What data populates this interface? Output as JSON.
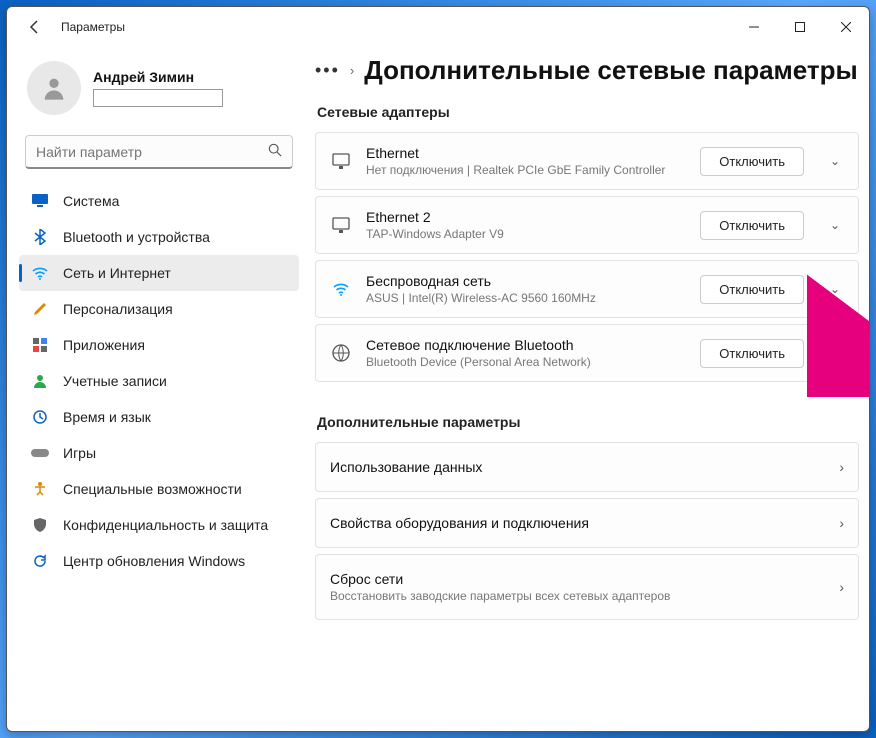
{
  "window": {
    "title": "Параметры"
  },
  "profile": {
    "name": "Андрей Зимин"
  },
  "search": {
    "placeholder": "Найти параметр"
  },
  "nav": [
    {
      "label": "Система",
      "icon": "monitor",
      "cls": "ic-system"
    },
    {
      "label": "Bluetooth и устройства",
      "icon": "bluetooth",
      "cls": "ic-bt"
    },
    {
      "label": "Сеть и Интернет",
      "icon": "wifi",
      "cls": "ic-net",
      "active": true
    },
    {
      "label": "Персонализация",
      "icon": "brush",
      "cls": "ic-pers"
    },
    {
      "label": "Приложения",
      "icon": "apps",
      "cls": "ic-app"
    },
    {
      "label": "Учетные записи",
      "icon": "user",
      "cls": "ic-acc"
    },
    {
      "label": "Время и язык",
      "icon": "clock",
      "cls": "ic-time"
    },
    {
      "label": "Игры",
      "icon": "gamepad",
      "cls": "ic-game"
    },
    {
      "label": "Специальные возможности",
      "icon": "accessibility",
      "cls": "ic-acc2"
    },
    {
      "label": "Конфиденциальность и защита",
      "icon": "shield",
      "cls": "ic-priv"
    },
    {
      "label": "Центр обновления Windows",
      "icon": "update",
      "cls": "ic-upd"
    }
  ],
  "page": {
    "dots": "•••",
    "title": "Дополнительные сетевые параметры"
  },
  "sections": {
    "adapters_label": "Сетевые адаптеры",
    "additional_label": "Дополнительные параметры"
  },
  "adapters": [
    {
      "title": "Ethernet",
      "sub": "Нет подключения | Realtek PCIe GbE Family Controller",
      "btn": "Отключить",
      "icon": "eth"
    },
    {
      "title": "Ethernet 2",
      "sub": "TAP-Windows Adapter V9",
      "btn": "Отключить",
      "icon": "eth"
    },
    {
      "title": "Беспроводная сеть",
      "sub": "ASUS | Intel(R) Wireless-AC 9560 160MHz",
      "btn": "Отключить",
      "icon": "wifi"
    },
    {
      "title": "Сетевое подключение Bluetooth",
      "sub": "Bluetooth Device (Personal Area Network)",
      "btn": "Отключить",
      "icon": "globe"
    }
  ],
  "additional": [
    {
      "title": "Использование данных",
      "sub": ""
    },
    {
      "title": "Свойства оборудования и подключения",
      "sub": ""
    },
    {
      "title": "Сброс сети",
      "sub": "Восстановить заводские параметры всех сетевых адаптеров"
    }
  ]
}
